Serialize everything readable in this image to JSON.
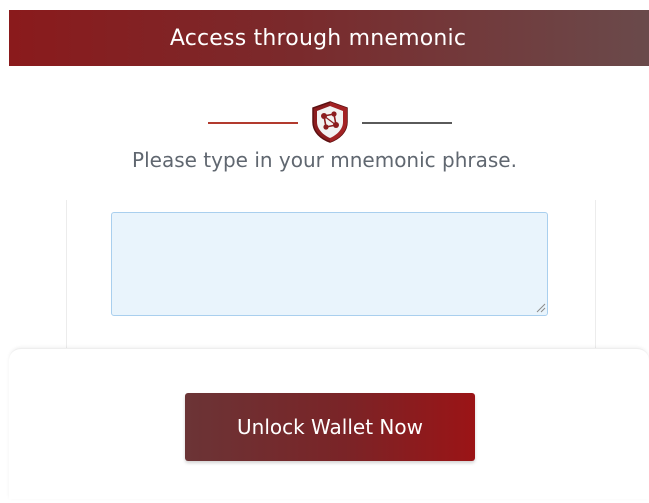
{
  "header": {
    "title": "Access through mnemonic"
  },
  "instruction": {
    "text": "Please type in your mnemonic phrase."
  },
  "mnemonic": {
    "value": "",
    "placeholder": ""
  },
  "actions": {
    "unlock_label": "Unlock Wallet Now"
  },
  "colors": {
    "header_start": "#8a1a1c",
    "header_end": "#6a4a4b",
    "line_left": "#b23a2e",
    "line_right": "#5a5a5a",
    "input_bg": "#e9f4fc",
    "input_border": "#a9cfee",
    "button_start": "#6b3436",
    "button_end": "#9b1416"
  },
  "icons": {
    "divider_icon": "shield-network-icon"
  }
}
